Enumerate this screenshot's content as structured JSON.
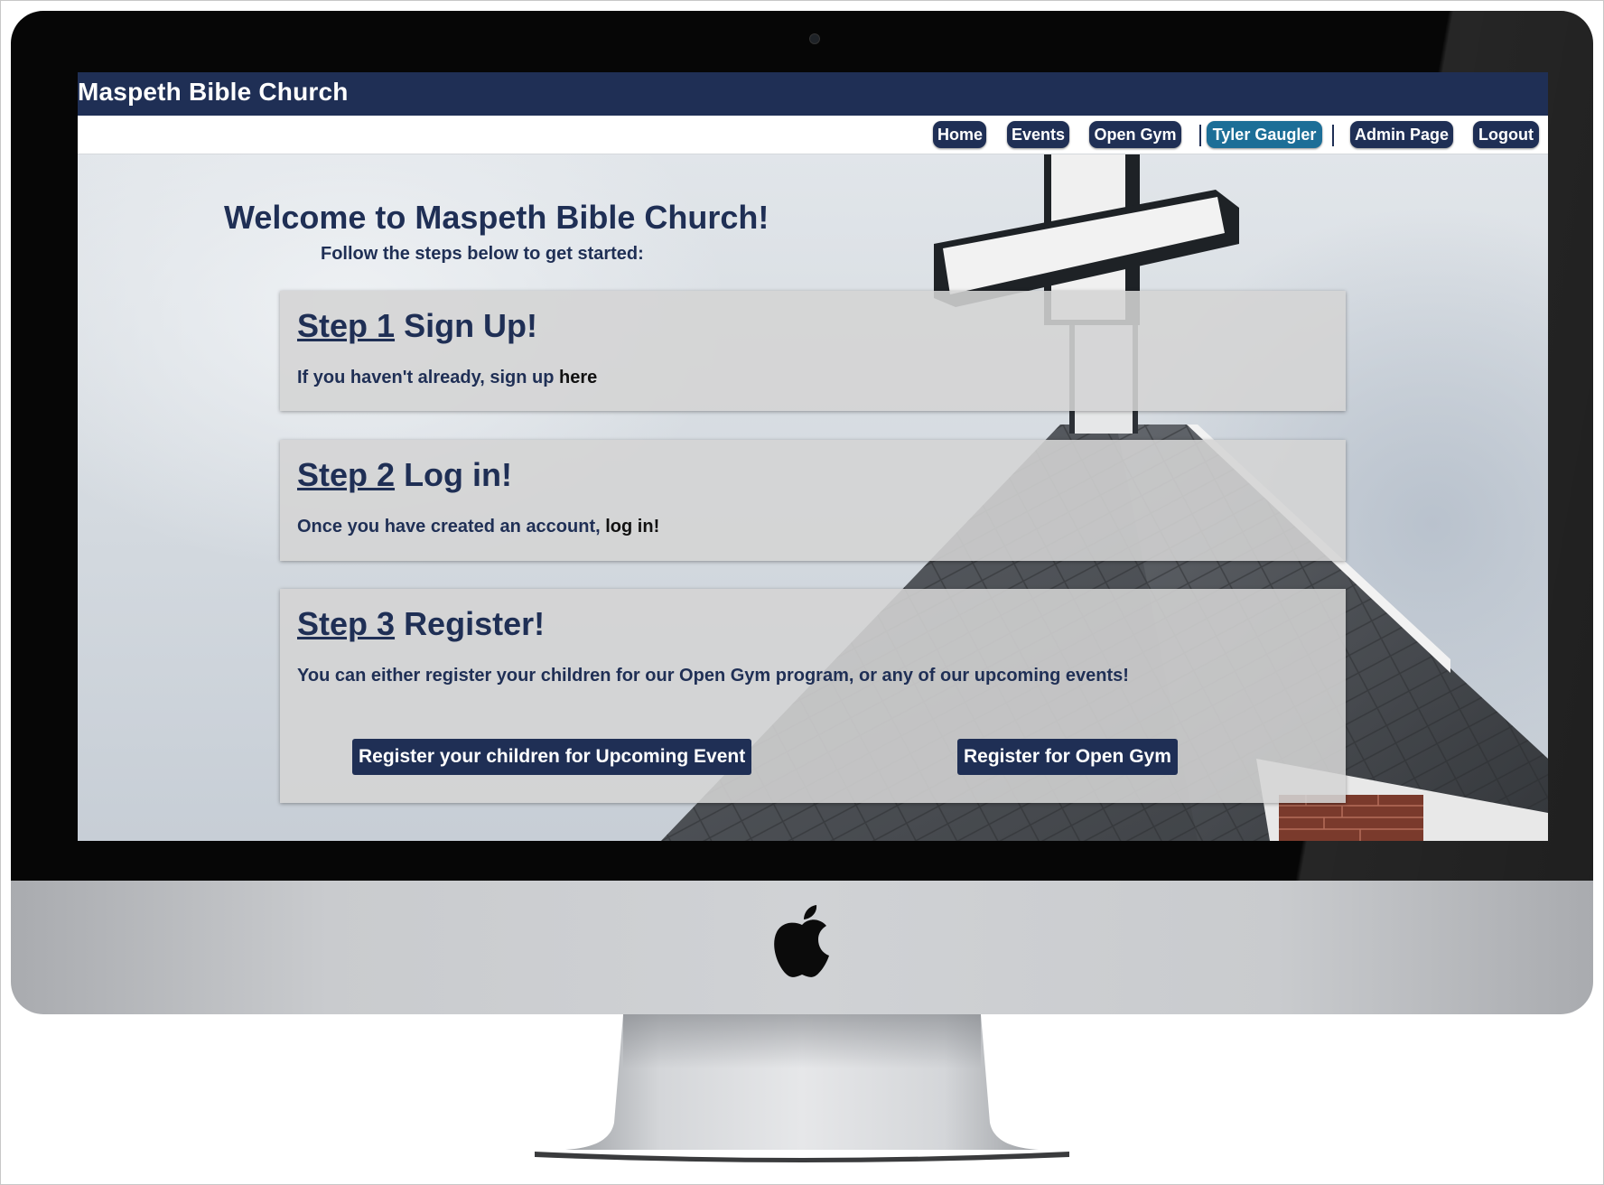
{
  "site": {
    "title": "Maspeth Bible Church"
  },
  "nav": {
    "home": "Home",
    "events": "Events",
    "open_gym": "Open Gym",
    "user": "Tyler Gaugler",
    "admin": "Admin Page",
    "logout": "Logout"
  },
  "hero": {
    "welcome": "Welcome to Maspeth Bible Church!",
    "subtitle": "Follow the steps below to get started:"
  },
  "steps": [
    {
      "link": "Step 1",
      "title": "Sign Up!",
      "text": "If you haven't already, sign up ",
      "link_text": "here",
      "text_after": ""
    },
    {
      "link": "Step 2",
      "title": "Log in!",
      "text": "Once you have created an account, ",
      "link_text": "log in",
      "text_after": "!"
    },
    {
      "link": "Step 3",
      "title": "Register!",
      "text": "You can either register your children for our Open Gym program, or any of our upcoming events!",
      "buttons": [
        "Register your children for Upcoming Event",
        "Register for Open Gym"
      ]
    }
  ],
  "colors": {
    "brand_navy": "#1f2f55",
    "active_nav": "#1c6e97",
    "card_bg": "#d4d4d4"
  },
  "icons": [
    "apple-logo-icon",
    "camera-icon"
  ]
}
